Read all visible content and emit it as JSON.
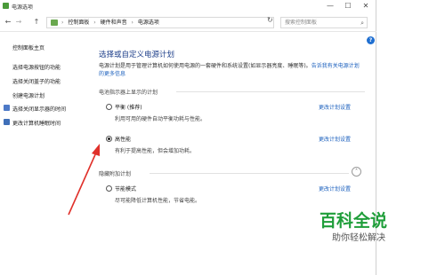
{
  "window": {
    "title": "电源选项",
    "controls": {
      "minimize": "—",
      "maximize": "☐",
      "close": "✕"
    }
  },
  "addressbar": {
    "back": "←",
    "forward": "→",
    "up": "↑",
    "crumbs": [
      "控制面板",
      "硬件和声音",
      "电源选项"
    ],
    "refresh": "↻",
    "search_placeholder": "搜索控制面板"
  },
  "help": "?",
  "sidebar": {
    "items": [
      {
        "label": "控制面板主页"
      },
      {
        "label": "选择电源按钮的功能"
      },
      {
        "label": "选择关闭盖子的功能"
      },
      {
        "label": "创建电源计划"
      },
      {
        "label": "选择关闭显示器的时间"
      },
      {
        "label": "更改计算机睡眠时间"
      }
    ]
  },
  "main": {
    "heading": "选择或自定义电源计划",
    "description_text": "电源计划是用于管理计算机如何使用电源的一套硬件和系统设置(如显示器亮度、睡眠等)。",
    "description_link_1": "告诉我有关电源计划",
    "description_link_2": "的更多信息",
    "section_shown": "电池指示器上显示的计划",
    "section_hidden": "隐藏附加计划",
    "plans": [
      {
        "name": "平衡 (推荐)",
        "desc": "利用可用的硬件自动平衡功耗与性能。",
        "link": "更改计划设置",
        "selected": false
      },
      {
        "name": "高性能",
        "desc": "有利于提高性能，但会增加功耗。",
        "link": "更改计划设置",
        "selected": true
      },
      {
        "name": "节能模式",
        "desc": "尽可能降低计算机性能，节省电能。",
        "link": "更改计划设置",
        "selected": false
      }
    ],
    "collapse_glyph": "˄"
  },
  "watermark": {
    "title": "百科全说",
    "subtitle": "助你轻松解决"
  },
  "colors": {
    "heading": "#1e3f8a",
    "link": "#1a5fbd",
    "arrow": "#e0302a",
    "watermark": "#1f9e3a"
  }
}
